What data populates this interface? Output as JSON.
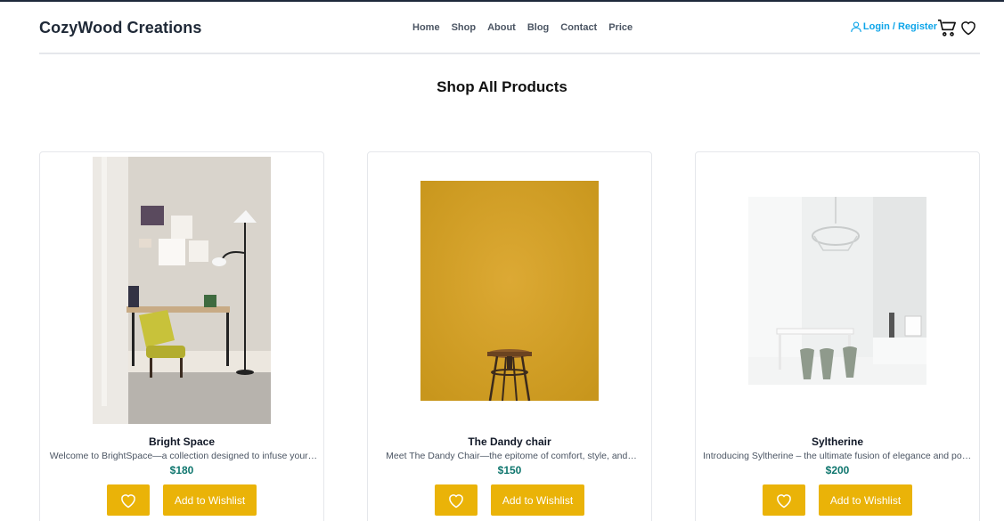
{
  "brand": "CozyWood Creations",
  "nav": [
    "Home",
    "Shop",
    "About",
    "Blog",
    "Contact",
    "Price"
  ],
  "account": {
    "label": "Login / Register"
  },
  "icons": {
    "account": "user-icon",
    "cart": "cart-icon",
    "wishlist": "heart-icon"
  },
  "page_title": "Shop All Products",
  "colors": {
    "accent": "#eab308",
    "price": "#0f766e",
    "link": "#0ea5e9"
  },
  "products": [
    {
      "name": "Bright Space",
      "description": "Welcome to BrightSpace—a collection designed to infuse your…",
      "price": "$180",
      "wishlist_label": "Add to Wishlist"
    },
    {
      "name": "The Dandy chair",
      "description": "Meet The Dandy Chair—the epitome of comfort, style, and…",
      "price": "$150",
      "wishlist_label": "Add to Wishlist"
    },
    {
      "name": "Syltherine",
      "description": "Introducing Syltherine – the ultimate fusion of elegance and power…",
      "price": "$200",
      "wishlist_label": "Add to Wishlist"
    }
  ]
}
